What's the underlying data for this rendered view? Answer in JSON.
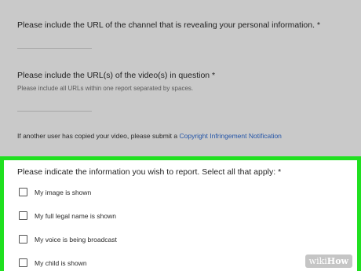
{
  "form": {
    "channel_url_question": "Please include the URL of the channel that is revealing your personal information. *",
    "video_urls_question": "Please include the URL(s) of the video(s) in question *",
    "video_urls_hint": "Please include all URLs within one report separated by spaces.",
    "copyright_notice_prefix": "If another user has copied your video, please submit a",
    "copyright_link": "Copyright Infringement Notification"
  },
  "report": {
    "title": "Please indicate the information you wish to report. Select all that apply: *",
    "options": [
      {
        "label": "My image is shown",
        "checked": false
      },
      {
        "label": "My full legal name is shown",
        "checked": false
      },
      {
        "label": "My voice is being broadcast",
        "checked": false
      },
      {
        "label": "My child is shown",
        "checked": false
      }
    ]
  },
  "colors": {
    "highlight_border": "#20e020",
    "link": "#2455a8",
    "background": "#c9c9c9"
  },
  "watermark": {
    "prefix": "wiki",
    "suffix": "How"
  }
}
